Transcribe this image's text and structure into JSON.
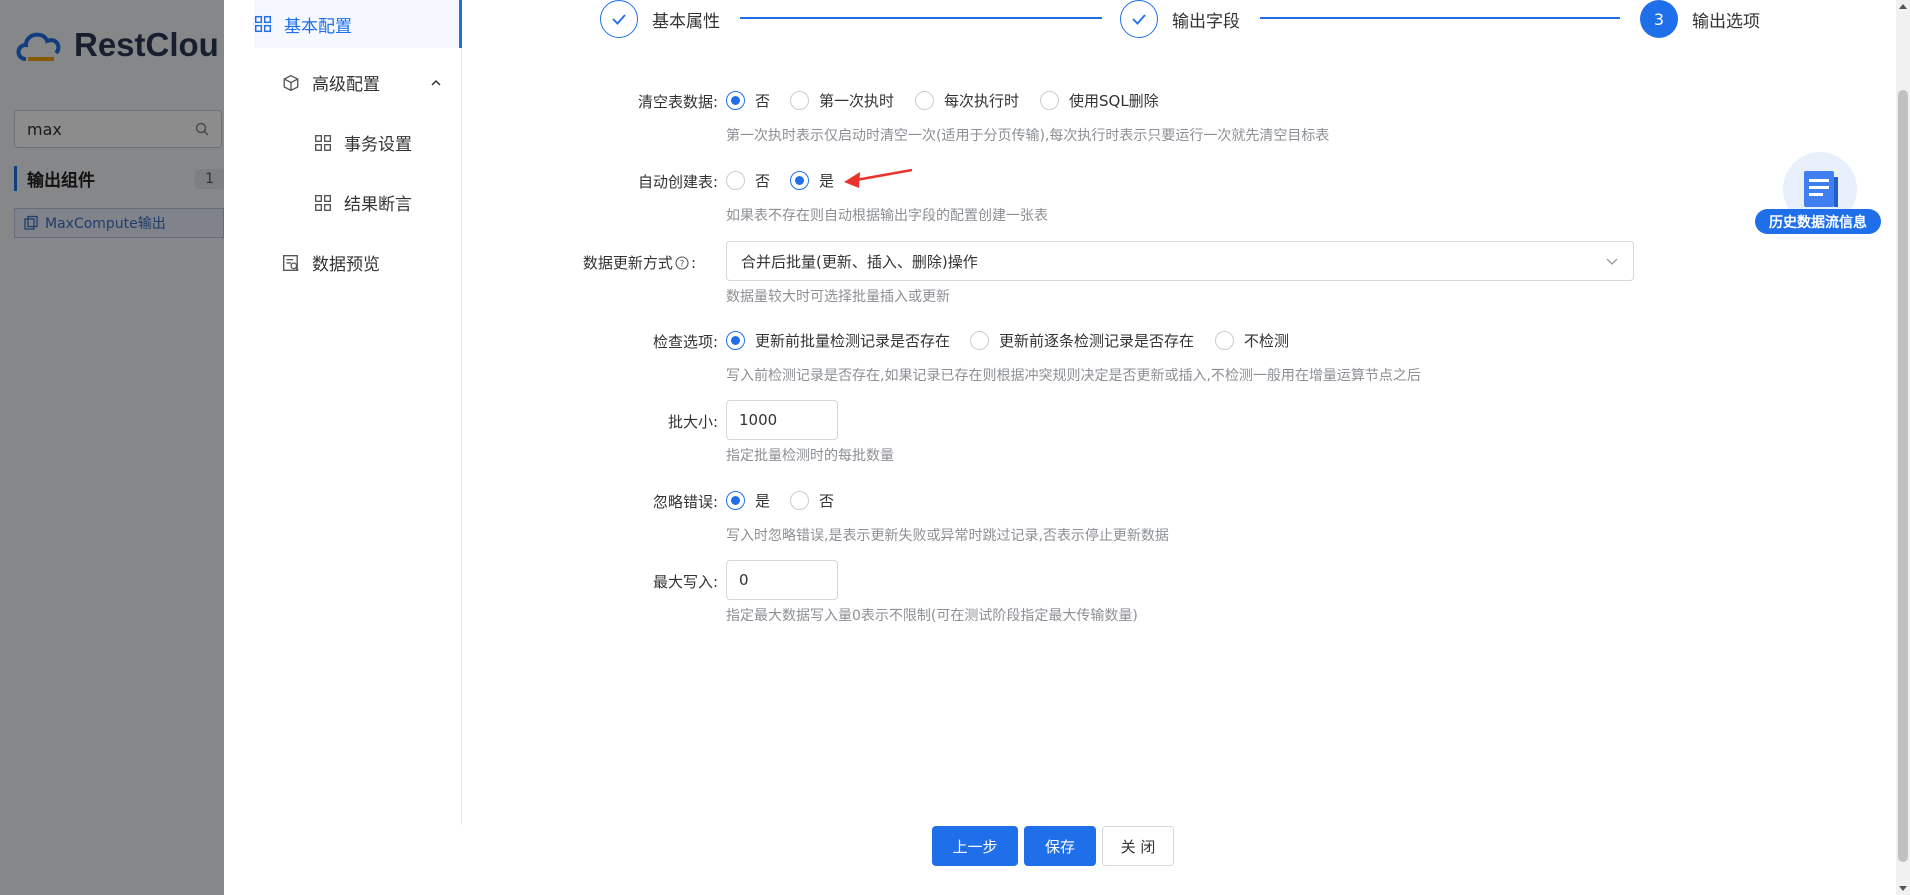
{
  "background": {
    "logo_text": "RestClou",
    "search_value": "max",
    "section_title": "输出组件",
    "section_count": "1",
    "component_item": "MaxCompute输出"
  },
  "nav": {
    "items": [
      {
        "label": "基本配置",
        "icon": "grid-icon",
        "active": true
      },
      {
        "label": "高级配置",
        "icon": "cube-icon",
        "expanded": true
      },
      {
        "label": "事务设置",
        "icon": "grid-icon"
      },
      {
        "label": "结果断言",
        "icon": "grid-icon"
      },
      {
        "label": "数据预览",
        "icon": "preview-icon"
      }
    ]
  },
  "steps": [
    {
      "label": "基本属性",
      "status": "done"
    },
    {
      "label": "输出字段",
      "status": "done"
    },
    {
      "label": "输出选项",
      "status": "current",
      "number": "3"
    }
  ],
  "form": {
    "clear_table": {
      "label": "清空表数据:",
      "options": [
        "否",
        "第一次执时",
        "每次执行时",
        "使用SQL删除"
      ],
      "selected": "否",
      "hint": "第一次执时表示仅启动时清空一次(适用于分页传输),每次执行时表示只要运行一次就先清空目标表"
    },
    "auto_create": {
      "label": "自动创建表:",
      "options": [
        "否",
        "是"
      ],
      "selected": "是",
      "hint": "如果表不存在则自动根据输出字段的配置创建一张表"
    },
    "update_mode": {
      "label": "数据更新方式",
      "value": "合并后批量(更新、插入、删除)操作",
      "hint": "数据量较大时可选择批量插入或更新"
    },
    "check_option": {
      "label": "检查选项:",
      "options": [
        "更新前批量检测记录是否存在",
        "更新前逐条检测记录是否存在",
        "不检测"
      ],
      "selected": "更新前批量检测记录是否存在",
      "hint": "写入前检测记录是否存在,如果记录已存在则根据冲突规则决定是否更新或插入,不检测一般用在增量运算节点之后"
    },
    "batch_size": {
      "label": "批大小:",
      "value": "1000",
      "hint": "指定批量检测时的每批数量"
    },
    "ignore_errors": {
      "label": "忽略错误:",
      "options": [
        "是",
        "否"
      ],
      "selected": "是",
      "hint": "写入时忽略错误,是表示更新失败或异常时跳过记录,否表示停止更新数据"
    },
    "max_write": {
      "label": "最大写入:",
      "value": "0",
      "hint": "指定最大数据写入量0表示不限制(可在测试阶段指定最大传输数量)"
    }
  },
  "buttons": {
    "prev": "上一步",
    "save": "保存",
    "close": "关 闭"
  },
  "float": {
    "label": "历史数据流信息"
  },
  "colors": {
    "accent": "#1f6feb",
    "annotation_arrow": "#e8342a"
  }
}
